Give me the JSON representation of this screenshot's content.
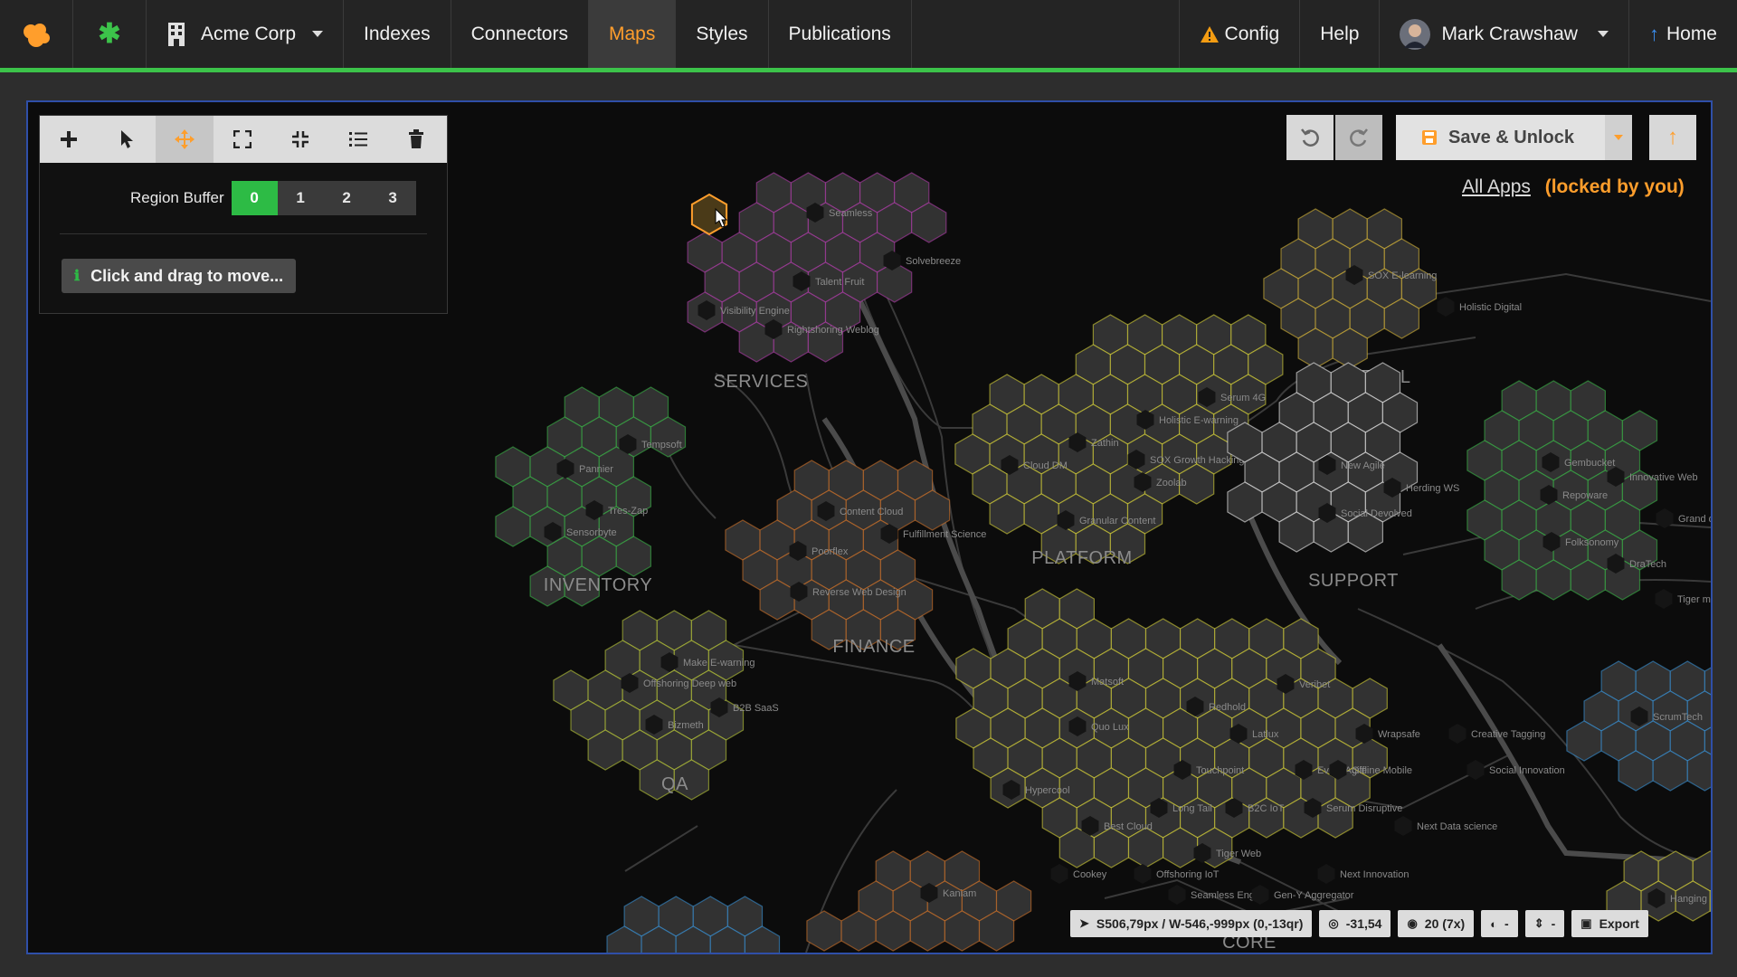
{
  "colors": {
    "accent": "#ff9e2c",
    "success": "#2dbb45",
    "topbar_border": "#3cc34a",
    "warning": "#f39c12",
    "home_arrow": "#3a8ff0"
  },
  "topbar": {
    "org": "Acme Corp",
    "nav": [
      "Indexes",
      "Connectors",
      "Maps",
      "Styles",
      "Publications"
    ],
    "active_nav": "Maps",
    "config": "Config",
    "help": "Help",
    "user": "Mark Crawshaw",
    "home": "Home"
  },
  "tools": [
    "add-icon",
    "pointer-icon",
    "move-icon",
    "expand-icon",
    "collapse-icon",
    "list-icon",
    "trash-icon"
  ],
  "active_tool": "move-icon",
  "panel": {
    "buffer_label": "Region Buffer",
    "buffer_options": [
      "0",
      "1",
      "2",
      "3"
    ],
    "buffer_selected": "0",
    "hint": "Click and drag to move..."
  },
  "header": {
    "save_label": "Save & Unlock",
    "all_apps": "All Apps",
    "locked": "(locked by you)"
  },
  "status": {
    "cursor": "S506,79px / W-546,-999px (0,-13qr)",
    "target": "-31,54",
    "zoom": "20 (7x)",
    "a": "-",
    "b": "-",
    "export": "Export"
  },
  "regions": [
    {
      "id": "services",
      "label": "SERVICES",
      "color": "#c03fb8",
      "nodes": [
        "Seamless",
        "Solvebreeze",
        "Talent Fruit",
        "Visibility Engine",
        "Rightshoring Weblog"
      ]
    },
    {
      "id": "inventory",
      "label": "INVENTORY",
      "color": "#3cc34a",
      "nodes": [
        "Tempsoft",
        "Pannier",
        "Tres-Zap",
        "Sensorbyte"
      ]
    },
    {
      "id": "finance",
      "label": "FINANCE",
      "color": "#e07a2a",
      "nodes": [
        "Content Cloud",
        "Fulfillment Science",
        "Poorflex",
        "Reverse Web Design"
      ]
    },
    {
      "id": "qa",
      "label": "QA",
      "color": "#c8d83a",
      "nodes": [
        "Make E-warning",
        "Offshoring Deep web",
        "B2B SaaS",
        "Bizmeth"
      ]
    },
    {
      "id": "platform",
      "label": "PLATFORM",
      "color": "#e8e13a",
      "nodes": [
        "Serum 4G",
        "Holistic E-warning",
        "Zathin",
        "SOX Growth Hacking",
        "Cloud DM",
        "Zoolab",
        "Granular Content"
      ]
    },
    {
      "id": "legal",
      "label": "LEGAL",
      "color": "#e8c23a",
      "nodes": [
        "SOX E-learning",
        "Holistic Digital"
      ]
    },
    {
      "id": "support",
      "label": "SUPPORT",
      "color": "#ffffff",
      "nodes": [
        "New Agile",
        "Herding WS",
        "Social Devolved"
      ]
    },
    {
      "id": "core",
      "label": "CORE",
      "color": "#e8e13a",
      "nodes": [
        "Matsoft",
        "Veribet",
        "Redhold",
        "Quo Lux",
        "Latlux",
        "Wrapsafe",
        "Creative Tagging",
        "Touchpoint",
        "Event Agile",
        "Offline Mobile",
        "Social Innovation",
        "Hypercool",
        "Long Tail",
        "B2C IoT",
        "Serum Disruptive",
        "Best Cloud",
        "Next Data science",
        "Tiger Web",
        "Cookey",
        "Offshoring IoT",
        "Next Innovation",
        "Seamless Engine",
        "Gen-Y Aggregator",
        "Kaniam"
      ]
    },
    {
      "id": "east",
      "label": "",
      "color": "#3cc34a",
      "nodes": [
        "Gembucket",
        "Innovative Web",
        "Repoware",
        "Grand data",
        "Folksonomy",
        "DraTech",
        "Tiger mining"
      ]
    },
    {
      "id": "southeast",
      "label": "",
      "color": "#3a9de8",
      "nodes": [
        "ScrumTech"
      ]
    },
    {
      "id": "corner",
      "label": "",
      "color": "#e8e13a",
      "nodes": [
        "Hanging Front-end"
      ]
    }
  ]
}
